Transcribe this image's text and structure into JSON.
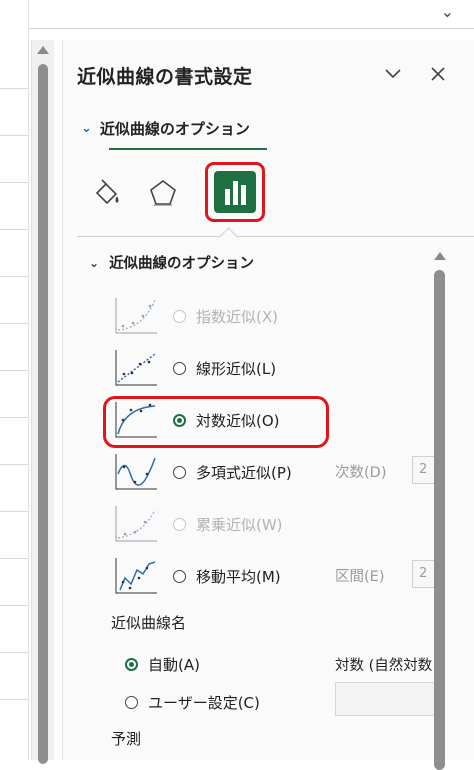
{
  "colors": {
    "accent": "#1e6f42",
    "highlight": "#e0151c",
    "disabled_text": "#b3b3b3"
  },
  "pane": {
    "title": "近似曲線の書式設定",
    "dropdown_icon": "chevron-down-icon",
    "close_icon": "close-icon"
  },
  "tab": {
    "label": "近似曲線のオプション"
  },
  "category_icons": [
    {
      "name": "fill-line-icon",
      "selected": false
    },
    {
      "name": "effects-pentagon-icon",
      "selected": false
    },
    {
      "name": "trendline-options-icon",
      "selected": true
    }
  ],
  "section": {
    "label": "近似曲線のオプション"
  },
  "trend_types": [
    {
      "label": "指数近似(X)",
      "enabled": false,
      "checked": false,
      "icon": "exponential-chart-icon"
    },
    {
      "label": "線形近似(L)",
      "enabled": true,
      "checked": false,
      "icon": "linear-chart-icon"
    },
    {
      "label": "対数近似(O)",
      "enabled": true,
      "checked": true,
      "icon": "logarithmic-chart-icon"
    },
    {
      "label": "多項式近似(P)",
      "enabled": true,
      "checked": false,
      "icon": "polynomial-chart-icon",
      "param_label": "次数(D)",
      "param_value": "2"
    },
    {
      "label": "累乗近似(W)",
      "enabled": false,
      "checked": false,
      "icon": "power-chart-icon"
    },
    {
      "label": "移動平均(M)",
      "enabled": true,
      "checked": false,
      "icon": "moving-average-chart-icon",
      "param_label": "区間(E)",
      "param_value": "2"
    }
  ],
  "trendline_name": {
    "header": "近似曲線名",
    "options": [
      {
        "label": "自動(A)",
        "checked": true
      },
      {
        "label": "ユーザー設定(C)",
        "checked": false
      }
    ],
    "auto_value": "対数 (自然対数)"
  },
  "forecast": {
    "header": "予測"
  }
}
